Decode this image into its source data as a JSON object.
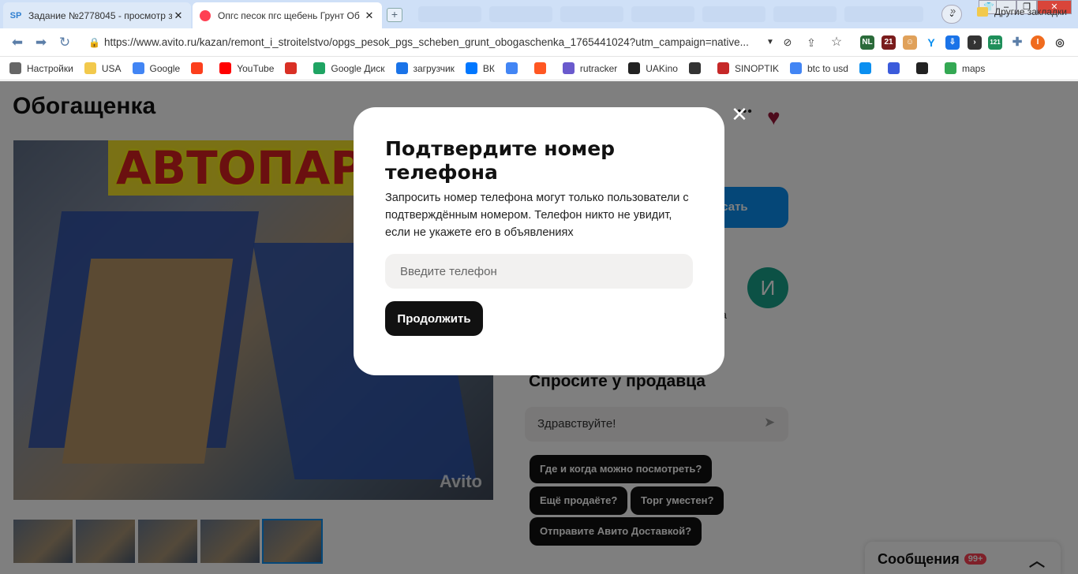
{
  "browser": {
    "tabs": [
      {
        "label": "Задание №2778045 - просмотр з",
        "icon": "sp-favicon"
      },
      {
        "label": "Опгс песок пгс щебень Грунт Об",
        "icon": "avito-favicon"
      }
    ],
    "url": "https://www.avito.ru/kazan/remont_i_stroitelstvo/opgs_pesok_pgs_scheben_grunt_obogaschenka_1765441024?utm_campaign=native..."
  },
  "bookmarks": [
    {
      "label": "Настройки",
      "icon": "gear-icon",
      "color": "#666666"
    },
    {
      "label": "USA",
      "icon": "folder-icon",
      "color": "#f2c94c"
    },
    {
      "label": "Google",
      "icon": "google-icon",
      "color": "#4285f4"
    },
    {
      "label": "",
      "icon": "yandex-icon",
      "color": "#fc3f1d"
    },
    {
      "label": "YouTube",
      "icon": "youtube-icon",
      "color": "#ff0000"
    },
    {
      "label": "",
      "icon": "gmail-icon",
      "color": "#d93025"
    },
    {
      "label": "Google Диск",
      "icon": "drive-icon",
      "color": "#1fa463"
    },
    {
      "label": "загрузчик",
      "icon": "infinity-icon",
      "color": "#1a73e8"
    },
    {
      "label": "ВК",
      "icon": "vk-icon",
      "color": "#0077ff"
    },
    {
      "label": "",
      "icon": "translate-icon",
      "color": "#4285f4"
    },
    {
      "label": "",
      "icon": "f-icon",
      "color": "#ff5722"
    },
    {
      "label": "rutracker",
      "icon": "rutracker-icon",
      "color": "#6a5acd"
    },
    {
      "label": "UAKino",
      "icon": "uakino-icon",
      "color": "#222222"
    },
    {
      "label": "",
      "icon": "chess-icon",
      "color": "#333333"
    },
    {
      "label": "SINOPTIK",
      "icon": "thermometer-icon",
      "color": "#c62828"
    },
    {
      "label": "btc to usd",
      "icon": "google-icon",
      "color": "#4285f4"
    },
    {
      "label": "",
      "icon": "p-icon",
      "color": "#0a8ff0"
    },
    {
      "label": "",
      "icon": "arrow-icon",
      "color": "#3b5bdb"
    },
    {
      "label": "",
      "icon": "bc-icon",
      "color": "#222222"
    },
    {
      "label": "maps",
      "icon": "maps-pin-icon",
      "color": "#34a853"
    }
  ],
  "bookmarks_more": "»",
  "bookmarks_other": "Другие закладки",
  "page": {
    "title": "Обогащенка",
    "watermark": "Avito",
    "image_banner": "АВТОПАРК",
    "write_button": "исать",
    "avatar_letter": "И",
    "seller_fragment": "да",
    "ask_title": "Спросите у продавца",
    "ask_input": "Здравствуйте!",
    "chips": [
      "Где и когда можно посмотреть?",
      "Ещё продаёте?",
      "Торг уместен?",
      "Отправите Авито Доставкой?"
    ],
    "messages_label": "Сообщения",
    "messages_badge": "99+"
  },
  "modal": {
    "title": "Подтвердите номер телефона",
    "text": "Запросить номер телефона могут только пользователи с подтверждённым номером. Телефон никто не увидит, если не укажете его в объявлениях",
    "phone_placeholder": "Введите телефон",
    "continue_label": "Продолжить"
  },
  "colors": {
    "accent": "#0a8ff0",
    "favorite": "#9a1638",
    "avatar": "#19a38a",
    "badge": "#ff4053"
  }
}
